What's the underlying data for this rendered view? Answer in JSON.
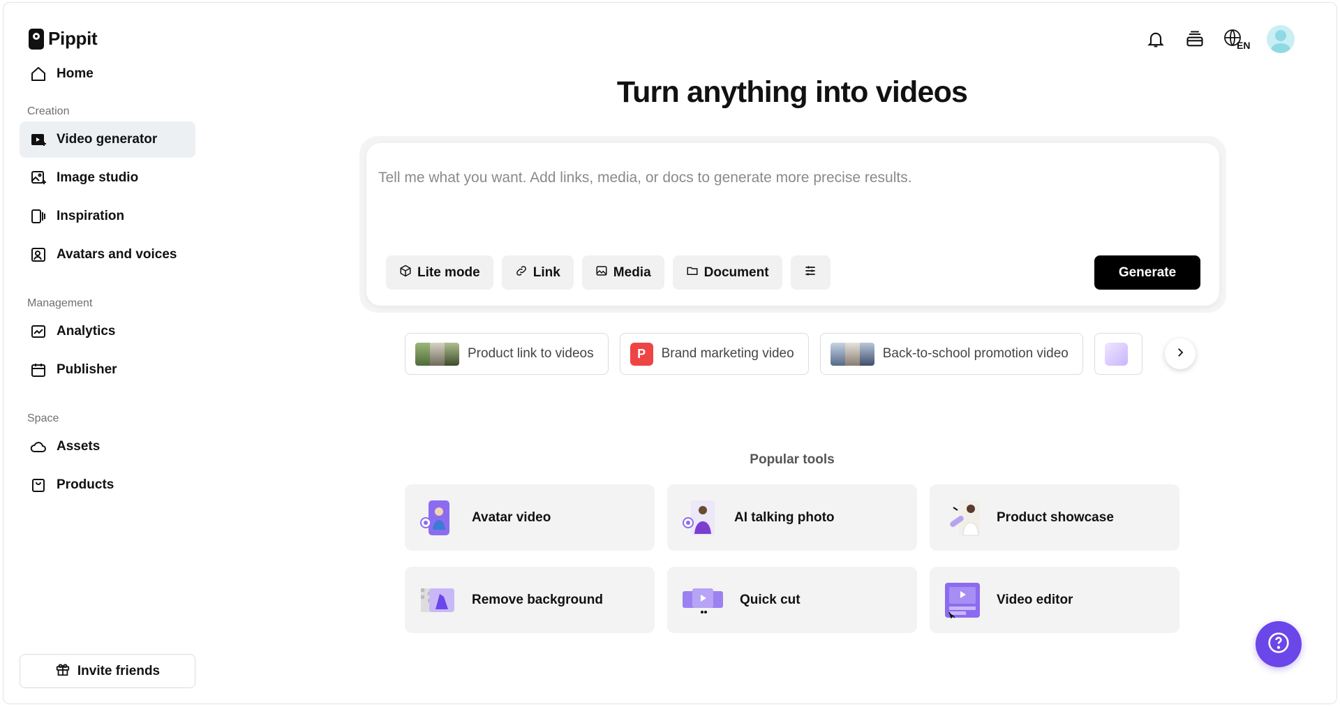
{
  "app": {
    "brand": "Pippit"
  },
  "sidebar": {
    "home": "Home",
    "sections": [
      {
        "label": "Creation"
      },
      {
        "label": "Management"
      },
      {
        "label": "Space"
      }
    ],
    "items": [
      {
        "label": "Video generator",
        "icon": "video-generator-icon",
        "active": true
      },
      {
        "label": "Image studio",
        "icon": "image-studio-icon"
      },
      {
        "label": "Inspiration",
        "icon": "inspiration-icon"
      },
      {
        "label": "Avatars and voices",
        "icon": "avatar-voice-icon"
      },
      {
        "label": "Analytics",
        "icon": "analytics-icon"
      },
      {
        "label": "Publisher",
        "icon": "calendar-icon"
      },
      {
        "label": "Assets",
        "icon": "cloud-icon"
      },
      {
        "label": "Products",
        "icon": "bag-icon"
      }
    ],
    "invite": "Invite friends"
  },
  "header": {
    "language": "EN"
  },
  "main": {
    "headline": "Turn anything into videos",
    "prompt": {
      "placeholder": "Tell me what you want. Add links, media, or docs to generate more precise results.",
      "value": ""
    },
    "chips": [
      "Lite mode",
      "Link",
      "Media",
      "Document"
    ],
    "generate": "Generate",
    "suggestions": [
      {
        "label": "Product link to videos"
      },
      {
        "label": "Brand marketing video",
        "badge": "P"
      },
      {
        "label": "Back-to-school promotion video"
      }
    ],
    "popular_title": "Popular tools",
    "tools": [
      {
        "label": "Avatar video"
      },
      {
        "label": "AI talking photo"
      },
      {
        "label": "Product showcase"
      },
      {
        "label": "Remove background"
      },
      {
        "label": "Quick cut"
      },
      {
        "label": "Video editor"
      }
    ]
  },
  "colors": {
    "accent": "#6b46e8",
    "active_nav": "#edf0f3",
    "generate_bg": "#000000",
    "card_bg": "#f3f3f3"
  }
}
